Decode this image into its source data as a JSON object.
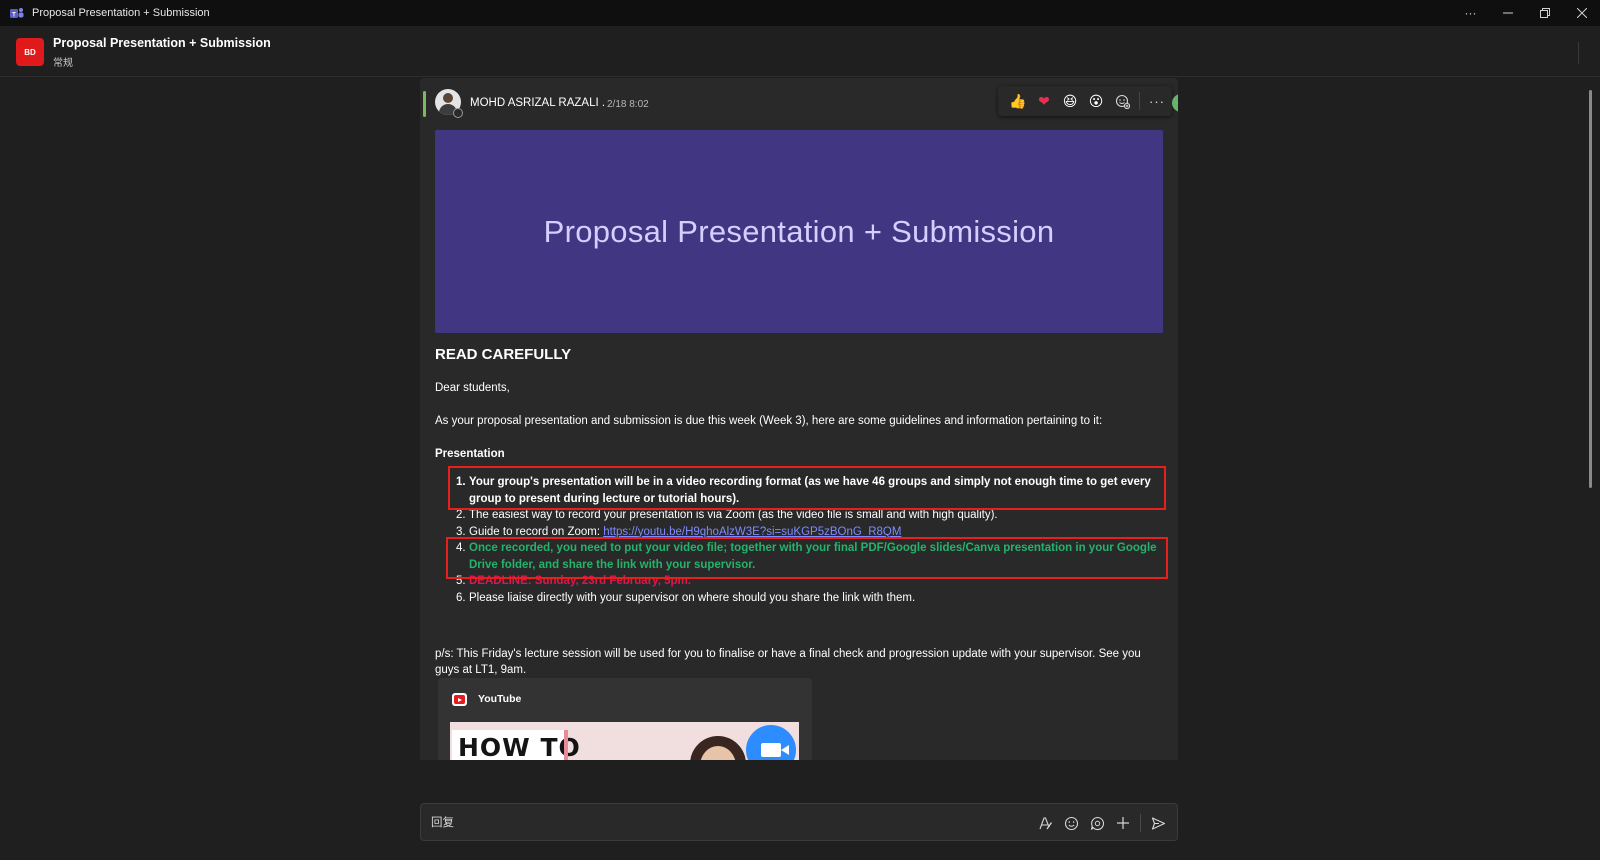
{
  "window": {
    "title": "Proposal Presentation + Submission",
    "more_label": "···"
  },
  "header": {
    "team_initials": "BD",
    "title": "Proposal Presentation + Submission",
    "subtitle": "常规",
    "team_color": "#e01a1a"
  },
  "post": {
    "author": "MOHD ASRIZAL RAZALI .",
    "time": "2/18 8:02",
    "reactions": [
      {
        "name": "like",
        "glyph": "👍"
      },
      {
        "name": "heart",
        "glyph": "❤"
      },
      {
        "name": "laugh",
        "glyph": "😆"
      },
      {
        "name": "surprised",
        "glyph": "😮"
      }
    ],
    "more_label": "···",
    "banner_title": "Proposal Presentation + Submission",
    "banner_color": "#413681",
    "heading": "READ CAREFULLY",
    "greeting": "Dear students,",
    "intro": "As your proposal presentation and submission is due this week (Week 3), here are some guidelines and information pertaining to it:",
    "section_title": "Presentation",
    "list": [
      {
        "num": "1.",
        "text": "Your group's presentation will be in a video recording format (as we have 46 groups and simply not enough time to get every group to present during lecture or tutorial hours)."
      },
      {
        "num": "2.",
        "text": "The easiest way to record your presentation is via Zoom (as the video file is small and with high quality)."
      },
      {
        "num": "3.",
        "text": "Guide to record on Zoom: ",
        "link": "https://youtu.be/H9qhoAlzW3E?si=suKGP5zBOnG_R8QM"
      },
      {
        "num": "4.",
        "text": "Once recorded, you need to put your video file; together with your final PDF/Google slides/Canva presentation in your Google Drive folder, and share the link with your supervisor."
      },
      {
        "num": "5.",
        "text": "DEADLINE: Sunday, 23rd February, 5pm."
      },
      {
        "num": "6.",
        "text": "Please liaise directly with your supervisor on where should you share the link with them."
      }
    ],
    "ps": "p/s: This Friday's lecture session will be used for you to finalise or have a final check and progression update with your supervisor. See you guys at LT1, 9am.",
    "preview": {
      "source": "YouTube",
      "thumb_text": "HOW TO"
    }
  },
  "reply": {
    "placeholder": "回复"
  },
  "colors": {
    "accent_green": "#7fba5a",
    "highlight_red": "#e8201d",
    "deadline_red": "#e0154d",
    "info_green": "#23b36b",
    "link": "#7d8cff"
  }
}
